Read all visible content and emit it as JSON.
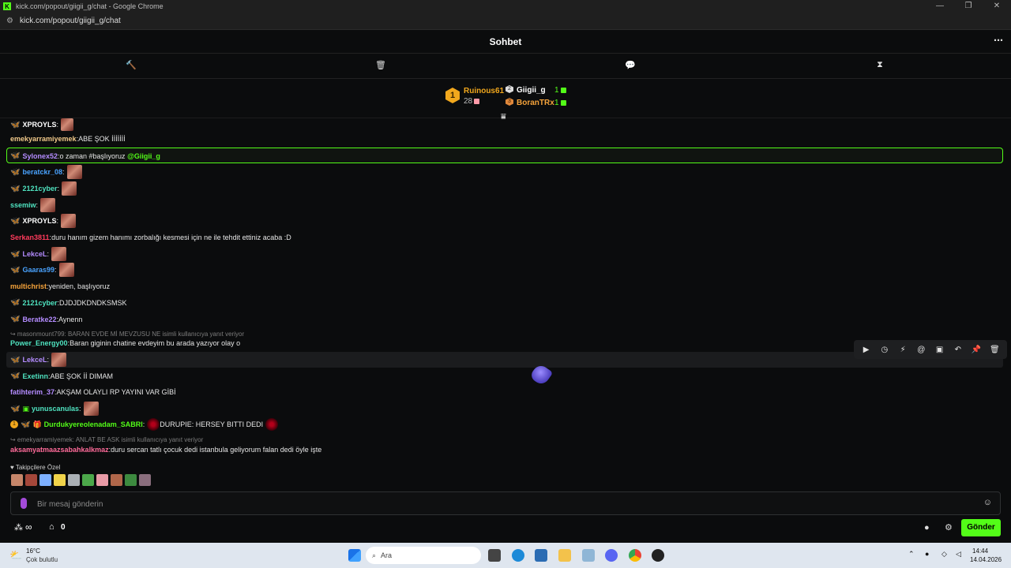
{
  "window": {
    "title": "kick.com/popout/giigii_g/chat - Google Chrome",
    "url": "kick.com/popout/giigii_g/chat",
    "controls": [
      "—",
      "❐",
      "✕"
    ]
  },
  "header": {
    "title": "Sohbet",
    "more_icon": "⋯"
  },
  "modbar": {
    "icons": [
      "🔨",
      "🗑",
      "💬",
      "⧗"
    ]
  },
  "leaderboard": {
    "first": {
      "rank": "1",
      "name": "Ruinous61",
      "count": "28"
    },
    "second": {
      "name": "Giigii_g",
      "count": "1"
    },
    "third": {
      "name": "BoranTRx",
      "count": "1"
    }
  },
  "chat": {
    "top_partial": {
      "user": "XPROYLS",
      "sep": ":"
    },
    "messages": [
      {
        "user": "emekyarramiyemek",
        "sep": ":",
        "text": " ABE ŞOK İİİİİİİ",
        "color": "#f1c98a"
      },
      {
        "user": "Sylonex52",
        "sep": ":",
        "text": " o zaman #başlıyoruz",
        "mention": "@Giigii_g",
        "color": "#b48cff"
      },
      {
        "user": "beratckr_08",
        "sep": ":",
        "text": "",
        "color": "#4aa3ff"
      },
      {
        "user": "2121cyber",
        "sep": ":",
        "text": "",
        "color": "#4fe3c0"
      },
      {
        "user": "ssemiw",
        "sep": ":",
        "text": "",
        "color": "#4fe3c0"
      },
      {
        "user": "XPROYLS",
        "sep": ":",
        "text": "",
        "color": "#ffffff"
      },
      {
        "user": "Serkan3811",
        "sep": ":",
        "text": " duru hanım gizem hanımı zorbalığı kesmesi için ne ile tehdit ettiniz acaba :D",
        "color": "#ff3b5c"
      },
      {
        "user": "LekceL",
        "sep": ":",
        "text": "",
        "color": "#b48cff"
      },
      {
        "user": "Gaaras99",
        "sep": ":",
        "text": "",
        "color": "#4aa3ff"
      },
      {
        "user": "multichrist",
        "sep": ":",
        "text": " yeniden, başlıyoruz",
        "color": "#f5a33b"
      },
      {
        "user": "2121cyber",
        "sep": ":",
        "text": " DJDJDKDNDKSMSK",
        "color": "#4fe3c0"
      },
      {
        "user": "Beratke22",
        "sep": ":",
        "text": " Aynenn",
        "color": "#b48cff"
      },
      {
        "user": "Power_Energy00",
        "sep": ":",
        "text": " Baran giginin chatine evdeyim bu arada yazıyor olay o",
        "color": "#4fe3c0"
      },
      {
        "user": "LekceL",
        "sep": ":",
        "text": "",
        "color": "#b48cff"
      },
      {
        "user": "Exetinn",
        "sep": ":",
        "text": " ABE ŞOK İİ DIMAM",
        "color": "#4fe3c0"
      },
      {
        "user": "fatihterim_37",
        "sep": ":",
        "text": " AKŞAM OLAYLI RP YAYINI VAR GİBİ",
        "color": "#b48cff"
      },
      {
        "user": "yunuscanulas",
        "sep": ":",
        "text": "",
        "color": "#4fe3c0"
      },
      {
        "user": "DurdukyereolenadamSABRI",
        "sep": ":",
        "text": " DURUPIE: HERSEY BITTI DEDI",
        "color": "#53fc18"
      },
      {
        "user": "aksamyatmaazsabahkalkmaz",
        "sep": ":",
        "text": " duru sercan tatlı çocuk dedi istanbula geliyorum falan dedi öyle işte",
        "color": "#ff6b9a"
      }
    ],
    "replies": [
      "↪ masonmount799: BARAN EVDE Mİ MEVZUSU NE isimli kullanıcıya yanıt veriyor",
      "↪ emekyarramiyemek: ANLAT BE ASK isimli kullanıcıya yanıt veriyor"
    ],
    "sabri_display": "Durdukyereolenadam_SABRI",
    "rank_badge": "1"
  },
  "mod_tools": [
    "▶",
    "◷",
    "⚡",
    "@",
    "▣",
    "↶",
    "📌",
    "🗑"
  ],
  "followers_only": {
    "label": "♥ Takipçilere Özel"
  },
  "composer": {
    "placeholder": "Bir mesaj gönderin",
    "send_label": "Gönder"
  },
  "bottom": {
    "infinity": "∞",
    "store_count": "0"
  },
  "taskbar": {
    "weather_temp": "16°C",
    "weather_desc": "Çok bulutlu",
    "search_placeholder": "Ara",
    "time": "14:44",
    "date": "14.04.2026"
  }
}
